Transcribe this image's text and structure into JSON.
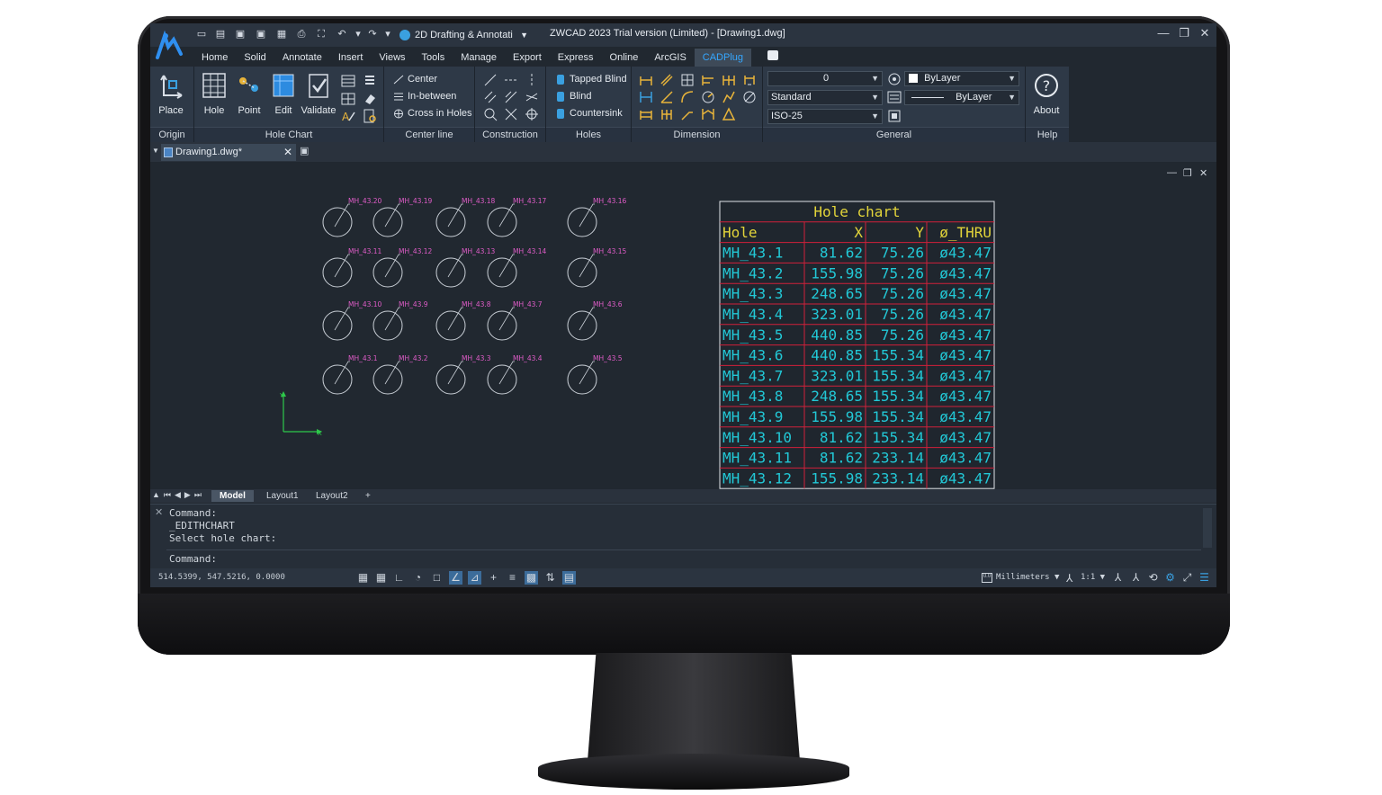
{
  "window": {
    "title": "ZWCAD 2023 Trial version (Limited) - [Drawing1.dwg]",
    "workspace": "2D Drafting & Annotati",
    "minimize": "—",
    "restore": "❐",
    "close": "✕"
  },
  "ribbon": {
    "tabs": [
      "Home",
      "Solid",
      "Annotate",
      "Insert",
      "Views",
      "Tools",
      "Manage",
      "Export",
      "Express",
      "Online",
      "ArcGIS",
      "CADPlug"
    ],
    "active_tab": "CADPlug",
    "groups": {
      "origin": {
        "label": "Origin",
        "place": "Place"
      },
      "hole_chart": {
        "label": "Hole Chart",
        "hole": "Hole",
        "point": "Point",
        "edit": "Edit",
        "validate": "Validate"
      },
      "center_line": {
        "label": "Center line",
        "center": "Center",
        "in_between": "In-between",
        "cross_in_holes": "Cross in Holes"
      },
      "construction": {
        "label": "Construction"
      },
      "holes": {
        "label": "Holes",
        "tapped_blind": "Tapped Blind",
        "blind": "Blind",
        "countersink": "Countersink"
      },
      "dimension": {
        "label": "Dimension"
      },
      "general": {
        "label": "General",
        "layer_value": "0",
        "text_style": "Standard",
        "dim_style": "ISO-25",
        "color": "ByLayer",
        "linetype": "ByLayer"
      },
      "help": {
        "label": "Help",
        "about": "About"
      }
    }
  },
  "document": {
    "tab_name": "Drawing1.dwg*"
  },
  "drawing": {
    "holes": [
      {
        "label": "MH_43.20",
        "col": 0,
        "row": 0
      },
      {
        "label": "MH_43.19",
        "col": 1,
        "row": 0
      },
      {
        "label": "MH_43.18",
        "col": 2,
        "row": 0
      },
      {
        "label": "MH_43.17",
        "col": 3,
        "row": 0
      },
      {
        "label": "MH_43.16",
        "col": 4,
        "row": 0
      },
      {
        "label": "MH_43.11",
        "col": 0,
        "row": 1
      },
      {
        "label": "MH_43.12",
        "col": 1,
        "row": 1
      },
      {
        "label": "MH_43.13",
        "col": 2,
        "row": 1
      },
      {
        "label": "MH_43.14",
        "col": 3,
        "row": 1
      },
      {
        "label": "MH_43.15",
        "col": 4,
        "row": 1
      },
      {
        "label": "MH_43.10",
        "col": 0,
        "row": 2
      },
      {
        "label": "MH_43.9",
        "col": 1,
        "row": 2
      },
      {
        "label": "MH_43.8",
        "col": 2,
        "row": 2
      },
      {
        "label": "MH_43.7",
        "col": 3,
        "row": 2
      },
      {
        "label": "MH_43.6",
        "col": 4,
        "row": 2
      },
      {
        "label": "MH_43.1",
        "col": 0,
        "row": 3
      },
      {
        "label": "MH_43.2",
        "col": 1,
        "row": 3
      },
      {
        "label": "MH_43.3",
        "col": 2,
        "row": 3
      },
      {
        "label": "MH_43.4",
        "col": 3,
        "row": 3
      },
      {
        "label": "MH_43.5",
        "col": 4,
        "row": 3
      }
    ],
    "ucs": {
      "x_label": "X",
      "y_label": "Y"
    },
    "hole_chart": {
      "title": "Hole chart",
      "headers": [
        "Hole",
        "X",
        "Y",
        "ø_THRU"
      ],
      "rows": [
        [
          "MH_43.1",
          "81.62",
          "75.26",
          "ø43.47"
        ],
        [
          "MH_43.2",
          "155.98",
          "75.26",
          "ø43.47"
        ],
        [
          "MH_43.3",
          "248.65",
          "75.26",
          "ø43.47"
        ],
        [
          "MH_43.4",
          "323.01",
          "75.26",
          "ø43.47"
        ],
        [
          "MH_43.5",
          "440.85",
          "75.26",
          "ø43.47"
        ],
        [
          "MH_43.6",
          "440.85",
          "155.34",
          "ø43.47"
        ],
        [
          "MH_43.7",
          "323.01",
          "155.34",
          "ø43.47"
        ],
        [
          "MH_43.8",
          "248.65",
          "155.34",
          "ø43.47"
        ],
        [
          "MH_43.9",
          "155.98",
          "155.34",
          "ø43.47"
        ],
        [
          "MH_43.10",
          "81.62",
          "155.34",
          "ø43.47"
        ],
        [
          "MH_43.11",
          "81.62",
          "233.14",
          "ø43.47"
        ],
        [
          "MH_43.12",
          "155.98",
          "233.14",
          "ø43.47"
        ]
      ]
    }
  },
  "layout_tabs": [
    "Model",
    "Layout1",
    "Layout2",
    "+"
  ],
  "command": {
    "history": [
      "Command:",
      "_EDITHCHART",
      "Select hole chart:"
    ],
    "prompt": "Command:"
  },
  "status": {
    "coords": "514.5399, 547.5216, 0.0000",
    "units": "Millimeters",
    "scale": "1:1"
  },
  "colors": {
    "accent": "#35a7ff",
    "hole_label": "#e05cc8",
    "table_grid": "#d0203a",
    "table_header": "#e2d43a",
    "table_text": "#22c8d6",
    "ucs": "#2ec84a"
  }
}
